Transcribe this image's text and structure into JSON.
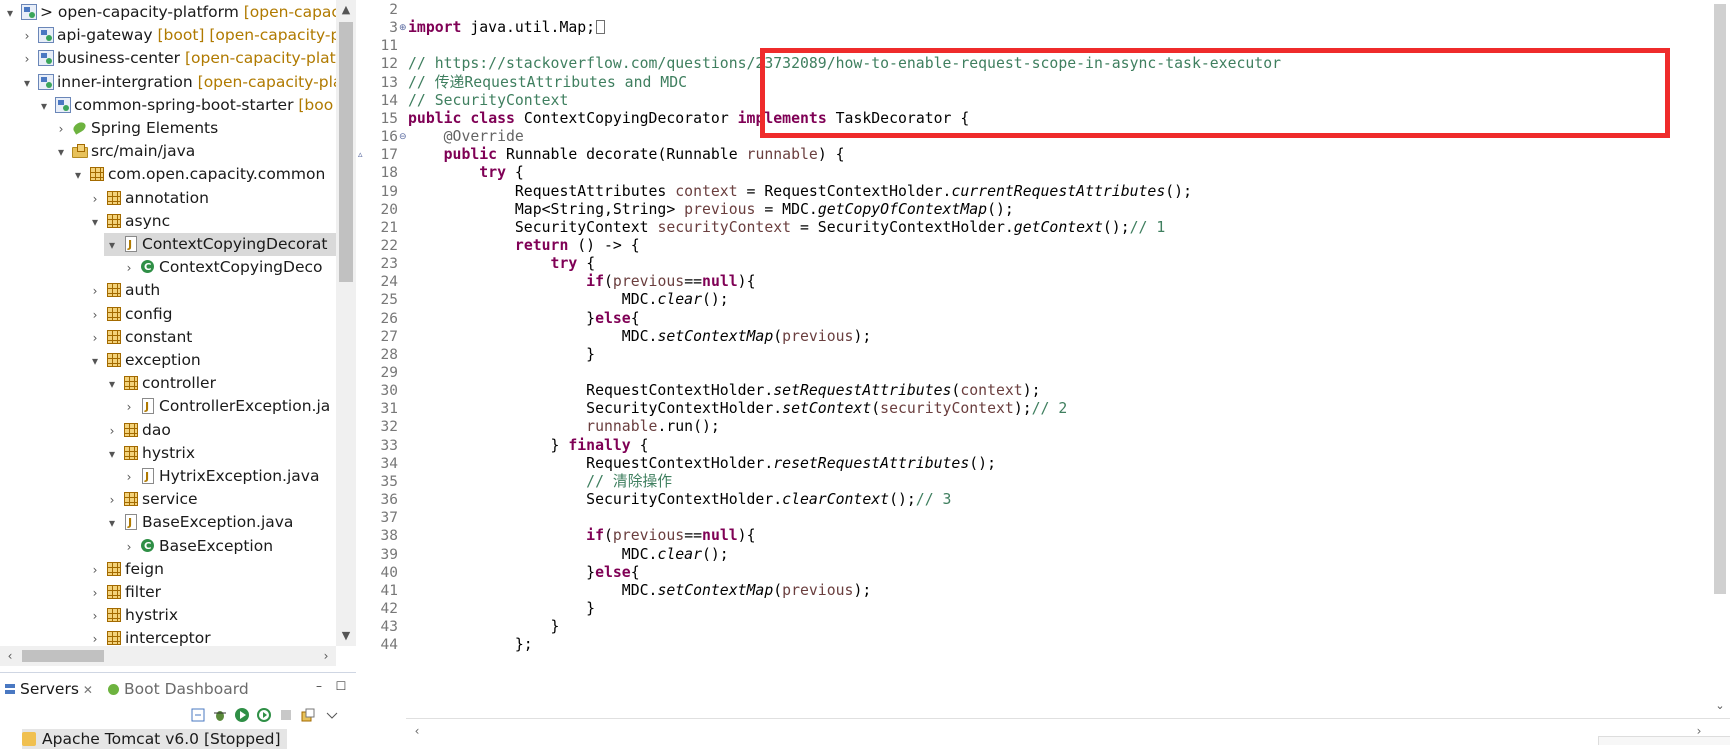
{
  "explorer": {
    "nodes": [
      {
        "twisty": "▾",
        "icon": "i-proj",
        "label": "> open-capacity-platform",
        "deco": " [open-capacit"
      },
      {
        "twisty": "›",
        "icon": "i-proj",
        "label": "api-gateway",
        "deco": " [boot] [open-capacity-pl"
      },
      {
        "twisty": "›",
        "icon": "i-proj",
        "label": "business-center",
        "deco": " [open-capacity-platfo"
      },
      {
        "twisty": "▾",
        "icon": "i-proj",
        "label": "inner-intergration",
        "deco": " [open-capacity-pla"
      },
      {
        "twisty": "▾",
        "icon": "i-proj",
        "label": "common-spring-boot-starter",
        "deco": " [boo"
      },
      {
        "twisty": "›",
        "icon": "i-spring",
        "label": "Spring Elements",
        "deco": ""
      },
      {
        "twisty": "▾",
        "icon": "i-srcfolder",
        "label": "src/main/java",
        "deco": ""
      },
      {
        "twisty": "▾",
        "icon": "i-pkg",
        "label": "com.open.capacity.common",
        "deco": ""
      },
      {
        "twisty": "›",
        "icon": "i-pkg",
        "label": "annotation",
        "deco": ""
      },
      {
        "twisty": "▾",
        "icon": "i-pkg",
        "label": "async",
        "deco": ""
      },
      {
        "twisty": "▾",
        "icon": "i-java",
        "label": "ContextCopyingDecorat",
        "deco": "",
        "selected": true
      },
      {
        "twisty": "›",
        "icon": "i-class",
        "label": "ContextCopyingDeco",
        "deco": ""
      },
      {
        "twisty": "›",
        "icon": "i-pkg",
        "label": "auth",
        "deco": ""
      },
      {
        "twisty": "›",
        "icon": "i-pkg",
        "label": "config",
        "deco": ""
      },
      {
        "twisty": "›",
        "icon": "i-pkg",
        "label": "constant",
        "deco": ""
      },
      {
        "twisty": "▾",
        "icon": "i-pkg",
        "label": "exception",
        "deco": ""
      },
      {
        "twisty": "▾",
        "icon": "i-pkg",
        "label": "controller",
        "deco": ""
      },
      {
        "twisty": "›",
        "icon": "i-java",
        "label": "ControllerException.ja",
        "deco": ""
      },
      {
        "twisty": "›",
        "icon": "i-pkg",
        "label": "dao",
        "deco": ""
      },
      {
        "twisty": "▾",
        "icon": "i-pkg",
        "label": "hystrix",
        "deco": ""
      },
      {
        "twisty": "›",
        "icon": "i-java",
        "label": "HytrixException.java",
        "deco": ""
      },
      {
        "twisty": "›",
        "icon": "i-pkg",
        "label": "service",
        "deco": ""
      },
      {
        "twisty": "▾",
        "icon": "i-java",
        "label": "BaseException.java",
        "deco": ""
      },
      {
        "twisty": "›",
        "icon": "i-class",
        "label": "BaseException",
        "deco": ""
      },
      {
        "twisty": "›",
        "icon": "i-pkg",
        "label": "feign",
        "deco": ""
      },
      {
        "twisty": "›",
        "icon": "i-pkg",
        "label": "filter",
        "deco": ""
      },
      {
        "twisty": "›",
        "icon": "i-pkg",
        "label": "hystrix",
        "deco": ""
      },
      {
        "twisty": "›",
        "icon": "i-pkg",
        "label": "interceptor",
        "deco": ""
      }
    ]
  },
  "servers": {
    "tab_servers": "Servers",
    "tab_boot": "Boot Dashboard",
    "row": "Apache Tomcat v6.0  [Stopped]"
  },
  "editor": {
    "lines": [
      {
        "n": "2",
        "fold": "",
        "html": ""
      },
      {
        "n": "3",
        "fold": "⊕",
        "html": "<span class=\"kw\">import</span> java.util.Map;<span class=\"cursor-box\"></span>"
      },
      {
        "n": "11",
        "fold": "",
        "html": ""
      },
      {
        "n": "12",
        "fold": "",
        "html": "<span class=\"cm\">// https://stackoverflow.com/questions/23732089/how-to-enable-request-scope-in-async-task-executor</span>"
      },
      {
        "n": "13",
        "fold": "",
        "html": "<span class=\"cm\">// 传递RequestAttributes and MDC</span>"
      },
      {
        "n": "14",
        "fold": "",
        "html": "<span class=\"cm\">// SecurityContext</span>"
      },
      {
        "n": "15",
        "fold": "",
        "html": "<span class=\"kw\">public</span> <span class=\"kw\">class</span> ContextCopyingDecorator <span class=\"kw\">implements</span> TaskDecorator {"
      },
      {
        "n": "16",
        "fold": "⊖",
        "html": "    <span class=\"ann\">@Override</span>"
      },
      {
        "n": "17",
        "fold": "",
        "pre": "▵",
        "html": "    <span class=\"kw\">public</span> Runnable decorate(Runnable <span class=\"fld\">runnable</span>) {"
      },
      {
        "n": "18",
        "fold": "",
        "html": "        <span class=\"kw\">try</span> {"
      },
      {
        "n": "19",
        "fold": "",
        "html": "            RequestAttributes <span class=\"fld\">context</span> = RequestContextHolder.<span class=\"st\">currentRequestAttributes</span>();"
      },
      {
        "n": "20",
        "fold": "",
        "html": "            Map&lt;String,String&gt; <span class=\"fld\">previous</span> = MDC.<span class=\"st\">getCopyOfContextMap</span>();"
      },
      {
        "n": "21",
        "fold": "",
        "html": "            SecurityContext <span class=\"fld\">securityContext</span> = SecurityContextHolder.<span class=\"st\">getContext</span>();<span class=\"cm\">// 1</span>"
      },
      {
        "n": "22",
        "fold": "",
        "html": "            <span class=\"kw\">return</span> () -&gt; {"
      },
      {
        "n": "23",
        "fold": "",
        "html": "                <span class=\"kw\">try</span> {"
      },
      {
        "n": "24",
        "fold": "",
        "html": "                    <span class=\"kw\">if</span>(<span class=\"fld\">previous</span>==<span class=\"kw\">null</span>){"
      },
      {
        "n": "25",
        "fold": "",
        "html": "                        MDC.<span class=\"st\">clear</span>();"
      },
      {
        "n": "26",
        "fold": "",
        "html": "                    }<span class=\"kw\">else</span>{"
      },
      {
        "n": "27",
        "fold": "",
        "html": "                        MDC.<span class=\"st\">setContextMap</span>(<span class=\"fld\">previous</span>);"
      },
      {
        "n": "28",
        "fold": "",
        "html": "                    }"
      },
      {
        "n": "29",
        "fold": "",
        "html": ""
      },
      {
        "n": "30",
        "fold": "",
        "html": "                    RequestContextHolder.<span class=\"st\">setRequestAttributes</span>(<span class=\"fld\">context</span>);"
      },
      {
        "n": "31",
        "fold": "",
        "html": "                    SecurityContextHolder.<span class=\"st\">setContext</span>(<span class=\"fld\">securityContext</span>);<span class=\"cm\">// 2</span>"
      },
      {
        "n": "32",
        "fold": "",
        "html": "                    <span class=\"fld\">runnable</span>.run();"
      },
      {
        "n": "33",
        "fold": "",
        "html": "                } <span class=\"kw\">finally</span> {"
      },
      {
        "n": "34",
        "fold": "",
        "html": "                    RequestContextHolder.<span class=\"st\">resetRequestAttributes</span>();"
      },
      {
        "n": "35",
        "fold": "",
        "html": "                    <span class=\"cm\">// 清除操作</span>"
      },
      {
        "n": "36",
        "fold": "",
        "html": "                    SecurityContextHolder.<span class=\"st\">clearContext</span>();<span class=\"cm\">// 3</span>"
      },
      {
        "n": "37",
        "fold": "",
        "html": ""
      },
      {
        "n": "38",
        "fold": "",
        "html": "                    <span class=\"kw\">if</span>(<span class=\"fld\">previous</span>==<span class=\"kw\">null</span>){"
      },
      {
        "n": "39",
        "fold": "",
        "html": "                        MDC.<span class=\"st\">clear</span>();"
      },
      {
        "n": "40",
        "fold": "",
        "html": "                    }<span class=\"kw\">else</span>{"
      },
      {
        "n": "41",
        "fold": "",
        "html": "                        MDC.<span class=\"st\">setContextMap</span>(<span class=\"fld\">previous</span>);"
      },
      {
        "n": "42",
        "fold": "",
        "html": "                    }"
      },
      {
        "n": "43",
        "fold": "",
        "html": "                }"
      },
      {
        "n": "44",
        "fold": "",
        "html": "            };"
      }
    ]
  },
  "colors": {
    "highlight": "#ef2b2b",
    "keyword": "#7f0055",
    "comment": "#3f7f5f",
    "field": "#6a3e3e"
  }
}
